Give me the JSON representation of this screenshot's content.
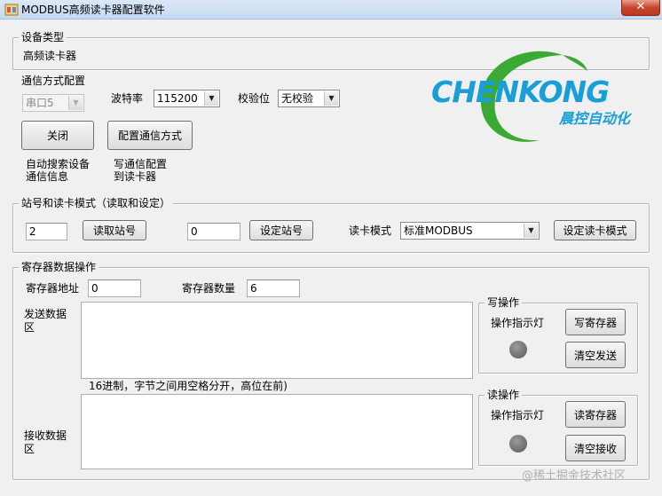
{
  "window": {
    "title": "MODBUS高频读卡器配置软件",
    "close_glyph": "✕"
  },
  "device_type": {
    "group_title": "设备类型",
    "value": "高频读卡器"
  },
  "comm_config": {
    "group_title": "通信方式配置",
    "port": "串口5",
    "baud_label": "波特率",
    "baud": "115200",
    "parity_label": "校验位",
    "parity": "无校验",
    "close_button": "关闭",
    "config_button": "配置通信方式",
    "auto_search_note": "自动搜索设备\n通信信息",
    "write_config_note": "写通信配置\n到读卡器"
  },
  "logo": {
    "brand": "CHENKONG",
    "tagline": "晨控自动化",
    "color_blue": "#1a9ed8",
    "color_green": "#3aaa35"
  },
  "station": {
    "group_title": "站号和读卡模式（读取和设定）",
    "read_value": "2",
    "read_button": "读取站号",
    "set_value": "0",
    "set_button": "设定站号",
    "mode_label": "读卡模式",
    "mode_value": "标准MODBUS",
    "mode_button": "设定读卡模式"
  },
  "register": {
    "group_title": "寄存器数据操作",
    "addr_label": "寄存器地址",
    "addr_value": "0",
    "count_label": "寄存器数量",
    "count_value": "6",
    "send_label": "发送数据\n区",
    "hint": "16进制，字节之间用空格分开，高位在前)",
    "recv_label": "接收数据\n区",
    "write_op": {
      "title": "写操作",
      "indicator_label": "操作指示灯",
      "write_button": "写寄存器",
      "clear_button": "清空发送"
    },
    "read_op": {
      "title": "读操作",
      "indicator_label": "操作指示灯",
      "read_button": "读寄存器",
      "clear_button": "清空接收"
    }
  },
  "watermark": "@稀土掘金技术社区"
}
